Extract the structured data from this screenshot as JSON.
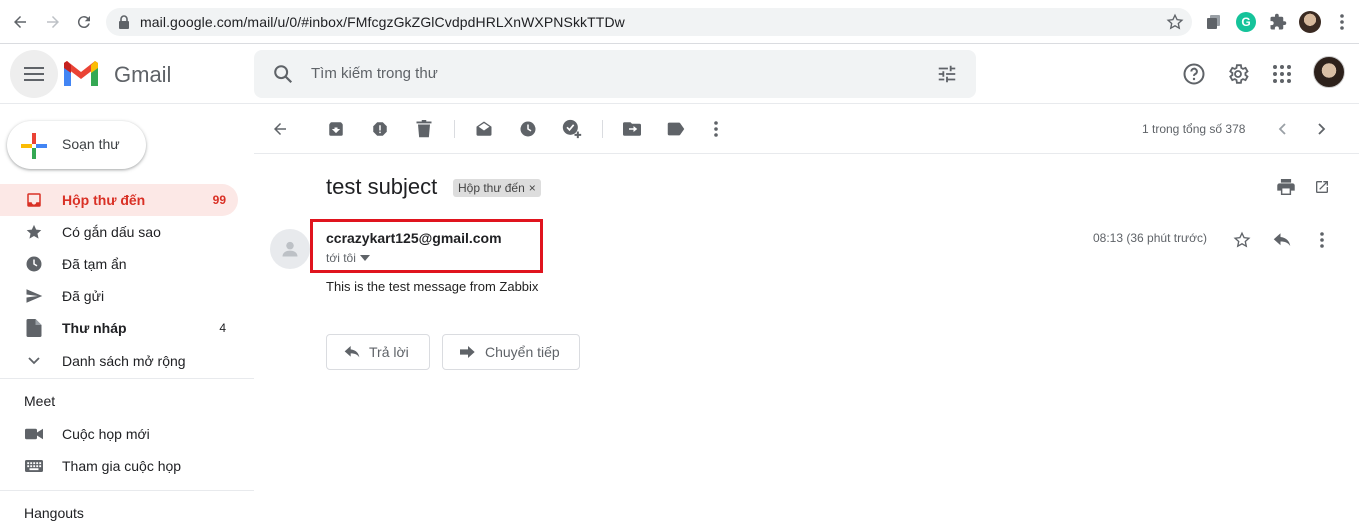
{
  "browser": {
    "url": "mail.google.com/mail/u/0/#inbox/FMfcgzGkZGlCvdpdHRLXnWXPNSkkTTDw",
    "extension_letter": "G"
  },
  "header": {
    "app_name": "Gmail",
    "search_placeholder": "Tìm kiếm trong thư"
  },
  "sidebar": {
    "compose_label": "Soạn thư",
    "items": [
      {
        "label": "Hộp thư đến",
        "count": "99",
        "icon": "inbox-icon"
      },
      {
        "label": "Có gắn dấu sao",
        "count": "",
        "icon": "star-icon"
      },
      {
        "label": "Đã tạm ẩn",
        "count": "",
        "icon": "clock-icon"
      },
      {
        "label": "Đã gửi",
        "count": "",
        "icon": "send-icon"
      },
      {
        "label": "Thư nháp",
        "count": "4",
        "icon": "draft-icon"
      },
      {
        "label": "Danh sách mở rộng",
        "count": "",
        "icon": "chevron-down-icon"
      }
    ],
    "meet_heading": "Meet",
    "meet_items": [
      {
        "label": "Cuộc họp mới",
        "icon": "video-icon"
      },
      {
        "label": "Tham gia cuộc họp",
        "icon": "keyboard-icon"
      }
    ],
    "hangouts_heading": "Hangouts"
  },
  "toolbar": {
    "pager_text": "1 trong tổng số 378"
  },
  "message": {
    "subject": "test subject",
    "label_chip": "Hộp thư đến",
    "label_close": "×",
    "sender": "ccrazykart125@gmail.com",
    "to_me": "tới tôi",
    "time": "08:13 (36 phút trước)",
    "body": "This is the test message from Zabbix",
    "reply_label": "Trả lời",
    "forward_label": "Chuyển tiếp"
  },
  "colors": {
    "accent_red": "#d93025",
    "active_bg": "#fce8e6",
    "highlight_border": "#e0141e"
  }
}
